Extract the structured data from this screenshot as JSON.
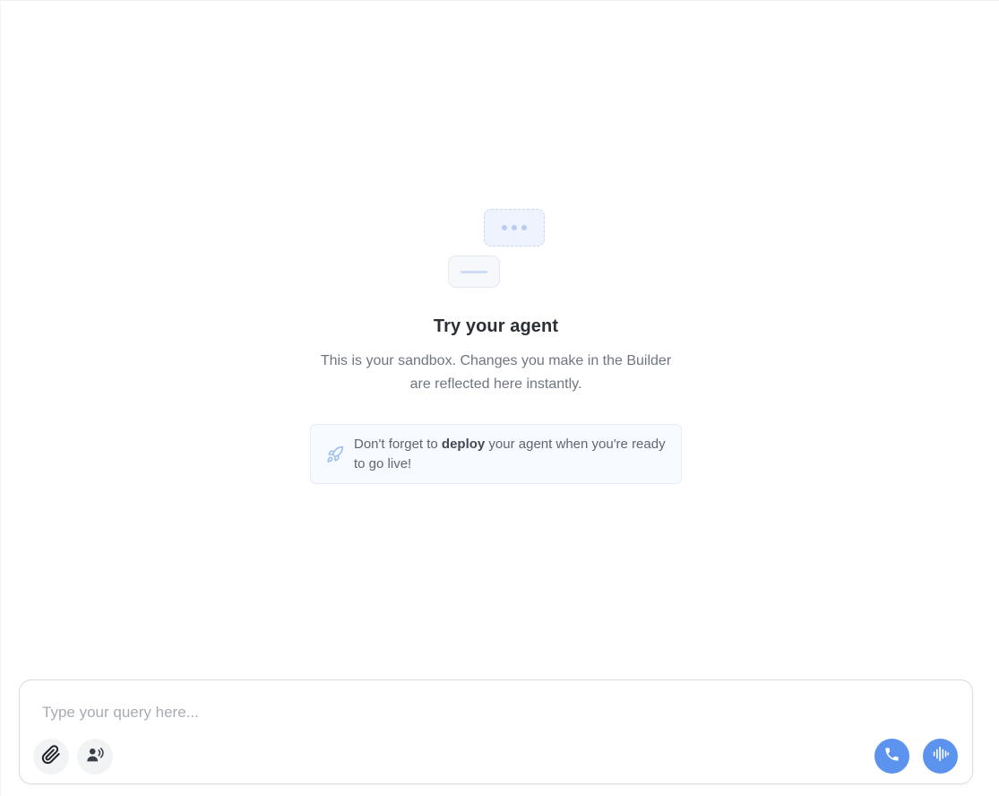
{
  "empty_state": {
    "title": "Try your agent",
    "subtitle": "This is your sandbox. Changes you make in the Builder are reflected here instantly.",
    "tip": {
      "icon": "rocket-icon",
      "prefix": "Don't forget to ",
      "bold": "deploy",
      "suffix": " your agent when you're ready to go live!"
    }
  },
  "composer": {
    "placeholder": "Type your query here...",
    "value": "",
    "left_tools": [
      "paperclip-icon",
      "voice-speaker-icon"
    ],
    "right_actions": [
      "phone-icon",
      "audio-wave-icon"
    ]
  },
  "colors": {
    "accent": "#5b93ef",
    "title": "#2b2f36",
    "muted": "#6f7683",
    "tip_bg": "#f7fafe"
  }
}
